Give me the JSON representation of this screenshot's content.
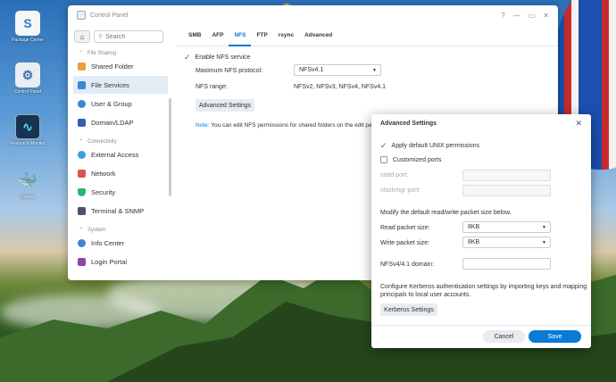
{
  "desktop": {
    "icons": [
      {
        "label": "Package Center",
        "icon": "package-icon"
      },
      {
        "label": "Control Panel",
        "icon": "control-panel-icon"
      },
      {
        "label": "Resource Monitor",
        "icon": "resource-monitor-icon"
      },
      {
        "label": "Docker",
        "icon": "docker-icon"
      }
    ]
  },
  "window": {
    "title": "Control Panel",
    "controls": [
      "?",
      "—",
      "▭",
      "✕"
    ]
  },
  "sidebar": {
    "search_placeholder": "Search",
    "sections": [
      {
        "title": "File Sharing",
        "items": [
          {
            "label": "Shared Folder",
            "color": "#e8a33a"
          },
          {
            "label": "File Services",
            "color": "#3b86d4",
            "active": true
          },
          {
            "label": "User & Group",
            "color": "#3b86d4"
          },
          {
            "label": "Domain/LDAP",
            "color": "#2f63b0"
          }
        ]
      },
      {
        "title": "Connectivity",
        "items": [
          {
            "label": "External Access",
            "color": "#3b9ee0"
          },
          {
            "label": "Network",
            "color": "#d9534f"
          },
          {
            "label": "Security",
            "color": "#2bb673"
          },
          {
            "label": "Terminal & SNMP",
            "color": "#4a5563"
          }
        ]
      },
      {
        "title": "System",
        "items": [
          {
            "label": "Info Center",
            "color": "#3b86d4"
          },
          {
            "label": "Login Portal",
            "color": "#8e44ad"
          }
        ]
      }
    ]
  },
  "tabs": [
    "SMB",
    "AFP",
    "NFS",
    "FTP",
    "rsync",
    "Advanced"
  ],
  "active_tab": "NFS",
  "nfs": {
    "enable_label": "Enable NFS service",
    "max_protocol_label": "Maximum NFS protocol:",
    "max_protocol_value": "NFSv4.1",
    "range_label": "NFS range:",
    "range_value": "NFSv2, NFSv3, NFSv4, NFSv4.1",
    "advanced_button": "Advanced Settings",
    "note_prefix": "Note:",
    "note_text": "You can edit NFS permissions for shared folders on the edit pag"
  },
  "dialog": {
    "title": "Advanced Settings",
    "apply_unix": "Apply default UNIX permissions",
    "customized_ports": "Customized ports",
    "statd_label": "statd port:",
    "nlockmgr_label": "nlockmgr port:",
    "packet_desc": "Modify the default read/write packet size below.",
    "read_label": "Read packet size:",
    "read_value": "8KB",
    "write_label": "Write packet size:",
    "write_value": "8KB",
    "domain_label": "NFSv4/4.1 domain:",
    "kerberos_desc_1": "Configure Kerberos authentication settings by importing keys and mapping",
    "kerberos_desc_2": "principals to local user accounts.",
    "kerberos_button": "Kerberos Settings",
    "cancel": "Cancel",
    "save": "Save"
  }
}
